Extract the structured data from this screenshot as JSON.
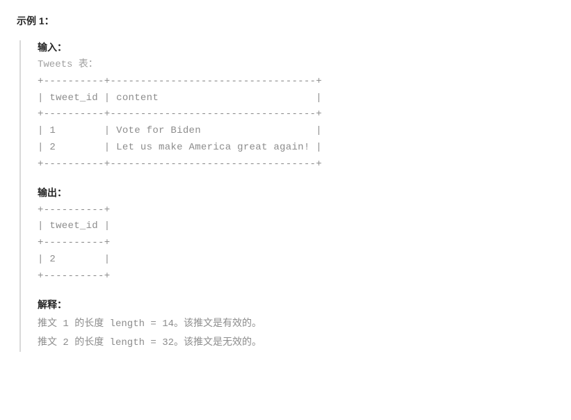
{
  "example_label": "示例 1：",
  "input": {
    "heading": "输入：",
    "subtext": "Tweets 表：",
    "table": "+----------+----------------------------------+\n| tweet_id | content                          |\n+----------+----------------------------------+\n| 1        | Vote for Biden                   |\n| 2        | Let us make America great again! |\n+----------+----------------------------------+"
  },
  "output": {
    "heading": "输出：",
    "table": "+----------+\n| tweet_id |\n+----------+\n| 2        |\n+----------+"
  },
  "explanation": {
    "heading": "解释：",
    "line1": "推文 1 的长度 length = 14。该推文是有效的。",
    "line2": "推文 2 的长度 length = 32。该推文是无效的。"
  }
}
